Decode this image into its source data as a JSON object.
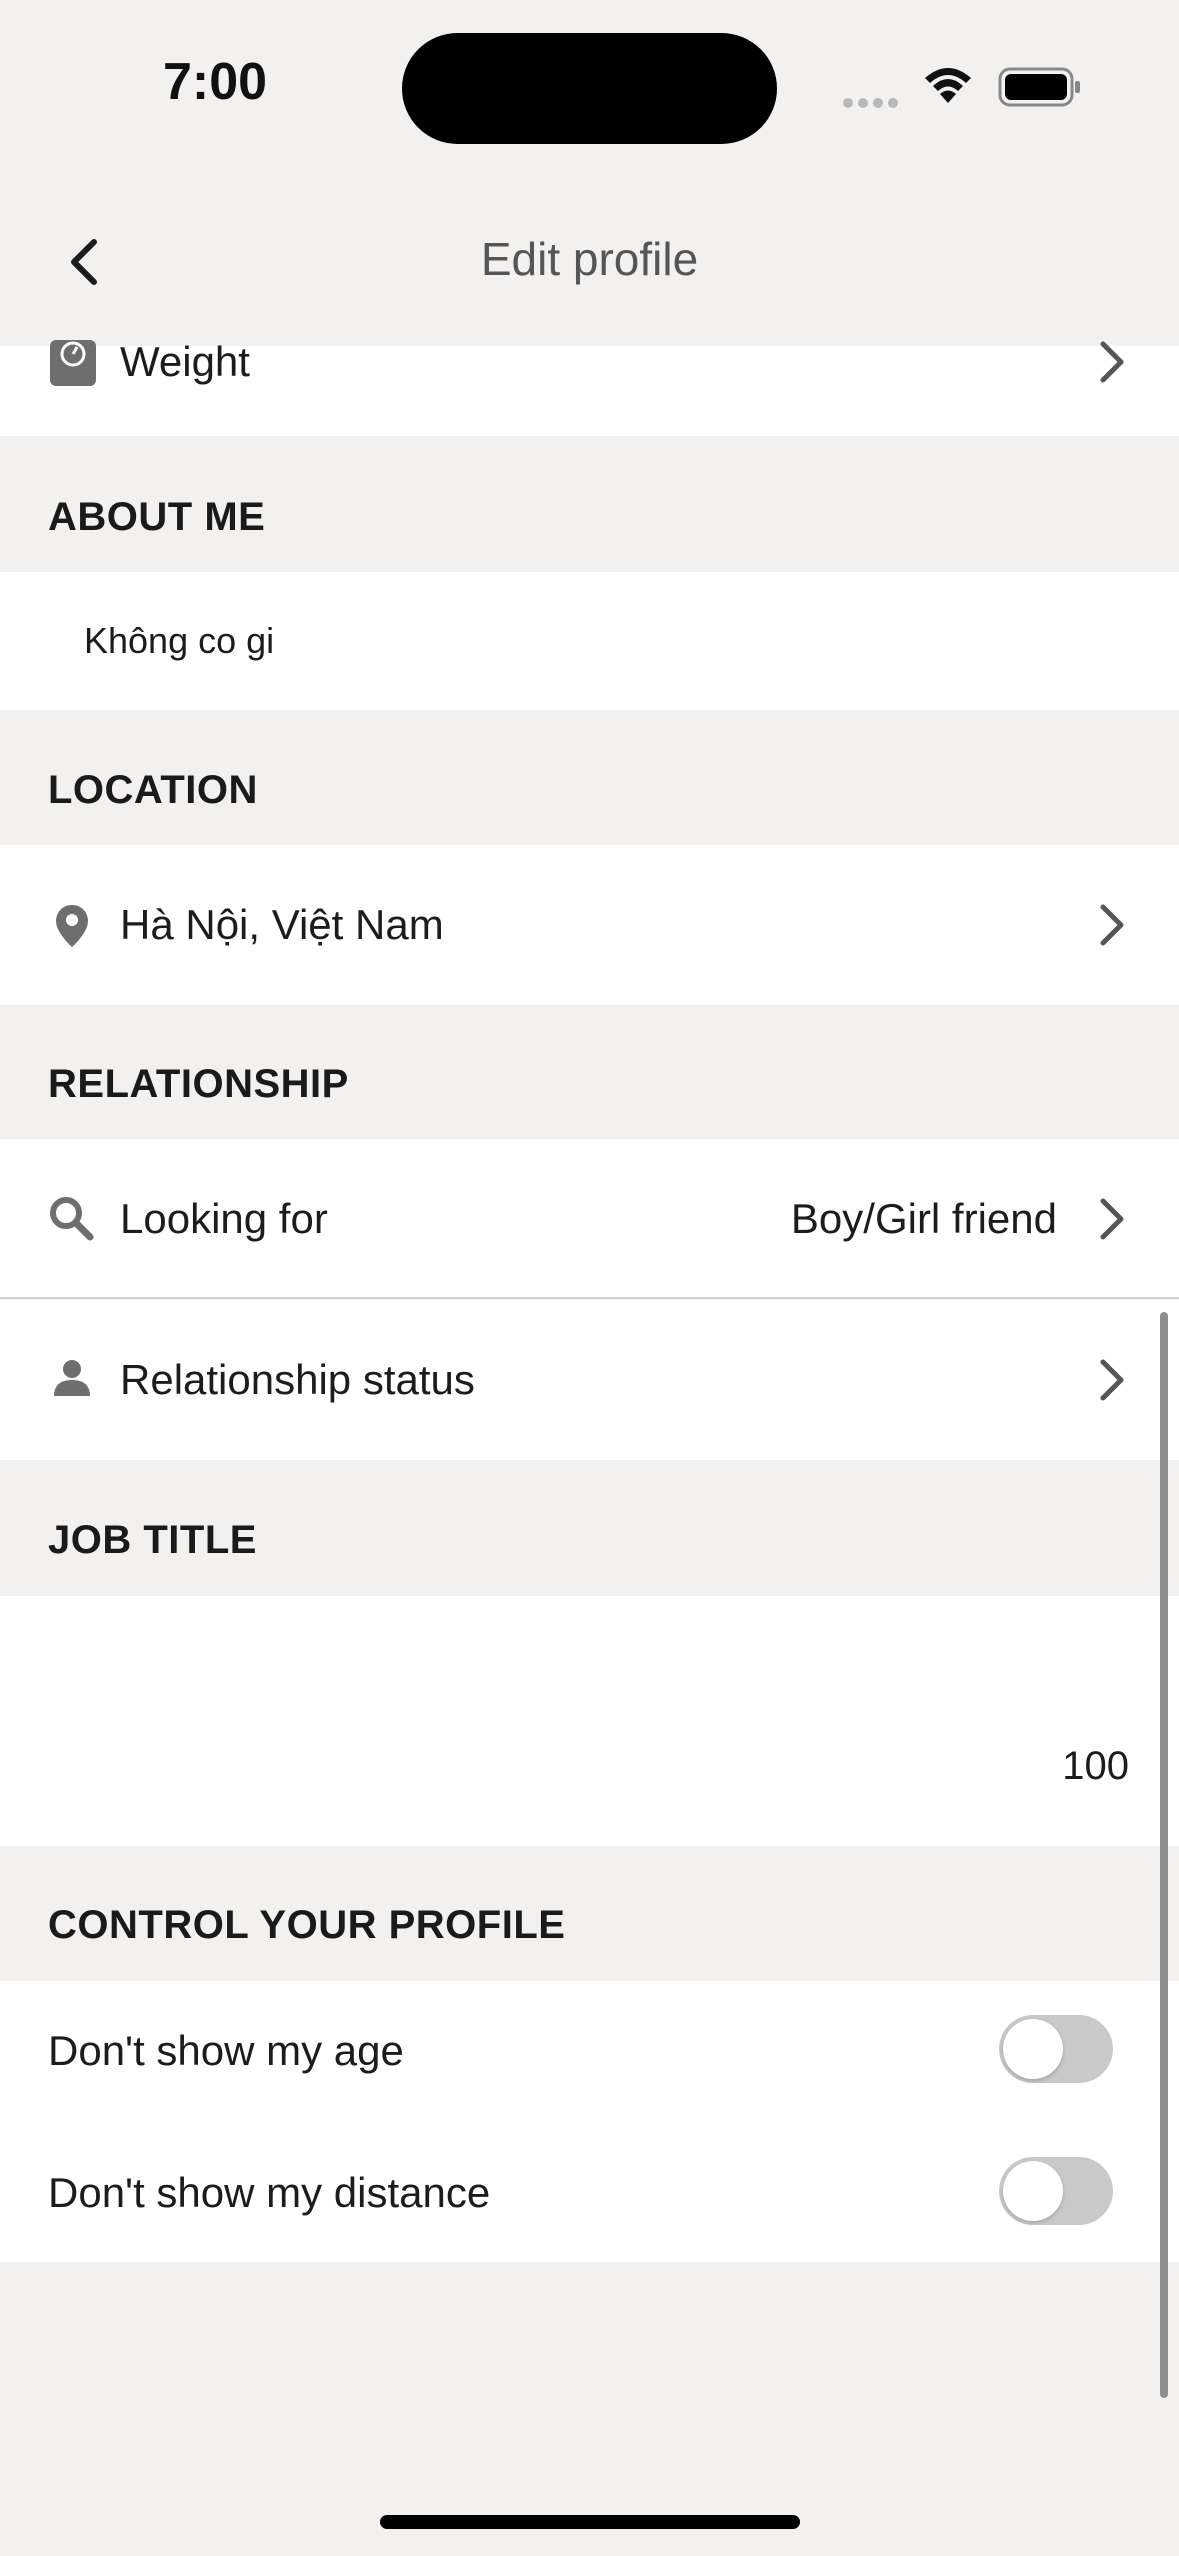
{
  "status_bar": {
    "time": "7:00"
  },
  "nav": {
    "title": "Edit profile"
  },
  "weight_row": {
    "label": "Weight"
  },
  "about_me": {
    "header": "ABOUT ME",
    "text": "Không co gi"
  },
  "location": {
    "header": "LOCATION",
    "value": "Hà Nội, Việt Nam"
  },
  "relationship": {
    "header": "RELATIONSHIP",
    "looking_for_label": "Looking for",
    "looking_for_value": "Boy/Girl friend",
    "status_label": "Relationship status"
  },
  "job_title": {
    "header": "JOB TITLE",
    "char_count": "100"
  },
  "control_profile": {
    "header": "CONTROL YOUR PROFILE",
    "hide_age_label": "Don't show my age",
    "hide_age_on": false,
    "hide_distance_label": "Don't show my distance",
    "hide_distance_on": false
  },
  "colors": {
    "background": "#f2f1f0",
    "row": "#ffffff",
    "icon": "#6e6e6e",
    "toggle_off": "#c9c9c9"
  }
}
